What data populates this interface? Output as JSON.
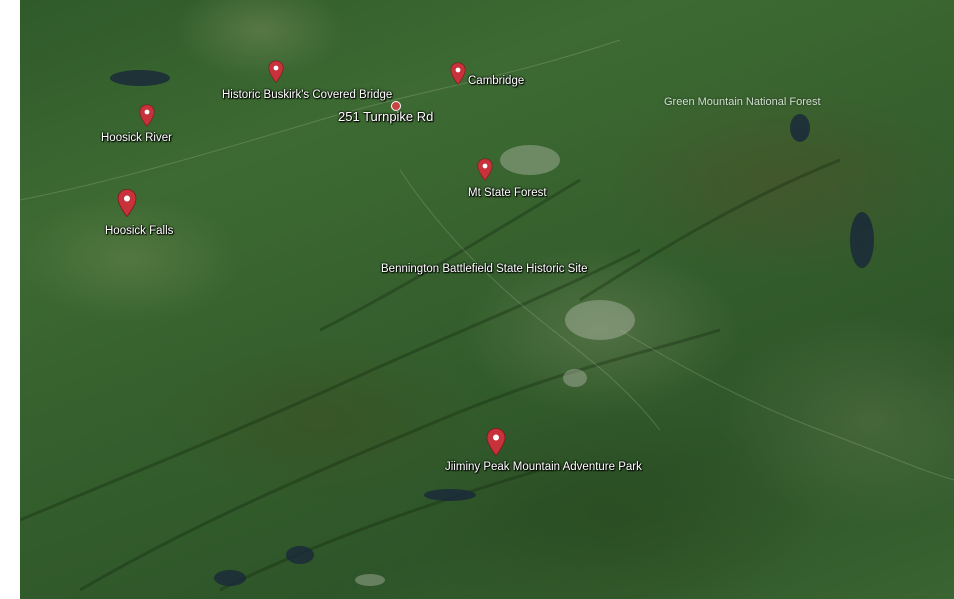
{
  "map": {
    "places": [
      {
        "id": "buskirk",
        "label": "Historic Buskirk's Covered Bridge"
      },
      {
        "id": "cambridge",
        "label": "Cambridge"
      },
      {
        "id": "hoosick-river",
        "label": "Hoosick River"
      },
      {
        "id": "mt-state-forest",
        "label": "Mt State Forest"
      },
      {
        "id": "hoosick-falls",
        "label": "Hoosick Falls"
      },
      {
        "id": "jiminy",
        "label": "Jiiminy Peak Mountain Adventure Park"
      }
    ],
    "address": "251 Turnpike Rd",
    "landmark": "Bennington Battlefield State Historic Site",
    "region": "Green Mountain National Forest",
    "pin_color": "#c8323a"
  }
}
